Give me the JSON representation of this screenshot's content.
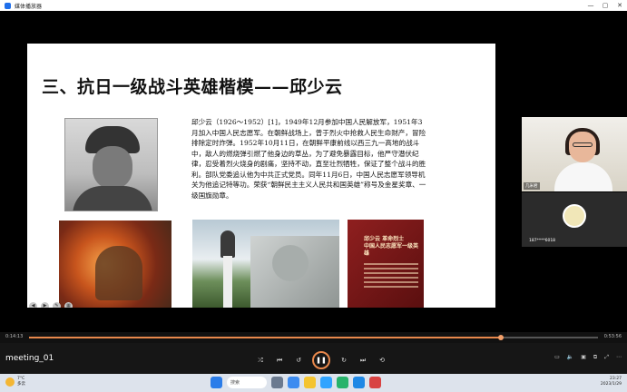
{
  "window": {
    "title": "媒体播放器",
    "controls": [
      "—",
      "▢",
      "✕"
    ]
  },
  "slide": {
    "title": "三、抗日一级战斗英雄楷模——邱少云",
    "paragraph": "邱少云（1926～1952）[1]，1949年12月参加中国人民解放军，1951年3月加入中国人民志愿军。在朝鲜战场上，曾于烈火中抢救人民生命财产，冒险排除定时炸弹。1952年10月11日，在朝鲜平康前线以西三九一高地的战斗中，敌人的燃烧弹引燃了他身边的草丛，为了避免暴露目标，他严守潜伏纪律，忍受着烈火烧身的剧痛，坚持不动，直至壮烈牺牲，保证了整个战斗的胜利。部队党委追认他为中共正式党员。同年11月6日，中国人民志愿军领导机关为他追记特等功。荣获“朝鲜民主主义人民共和国英雄”称号及金星奖章、一级国旗勋章。",
    "card_title": "邱少云 革命烈士\n中国人民志愿军一级英雄"
  },
  "participants": {
    "camera_name": "几米君",
    "user_name": "187****6018"
  },
  "player": {
    "current_time": "0:14:13",
    "total_time": "0:53:56",
    "progress": 0.83,
    "file_name": "meeting_01"
  },
  "taskbar": {
    "weather_temp": "7°C",
    "weather_desc": "多云",
    "search_placeholder": "搜索",
    "clock_time": "23:27",
    "clock_date": "2023/1/29"
  },
  "colors": {
    "accent": "#e8884c"
  }
}
